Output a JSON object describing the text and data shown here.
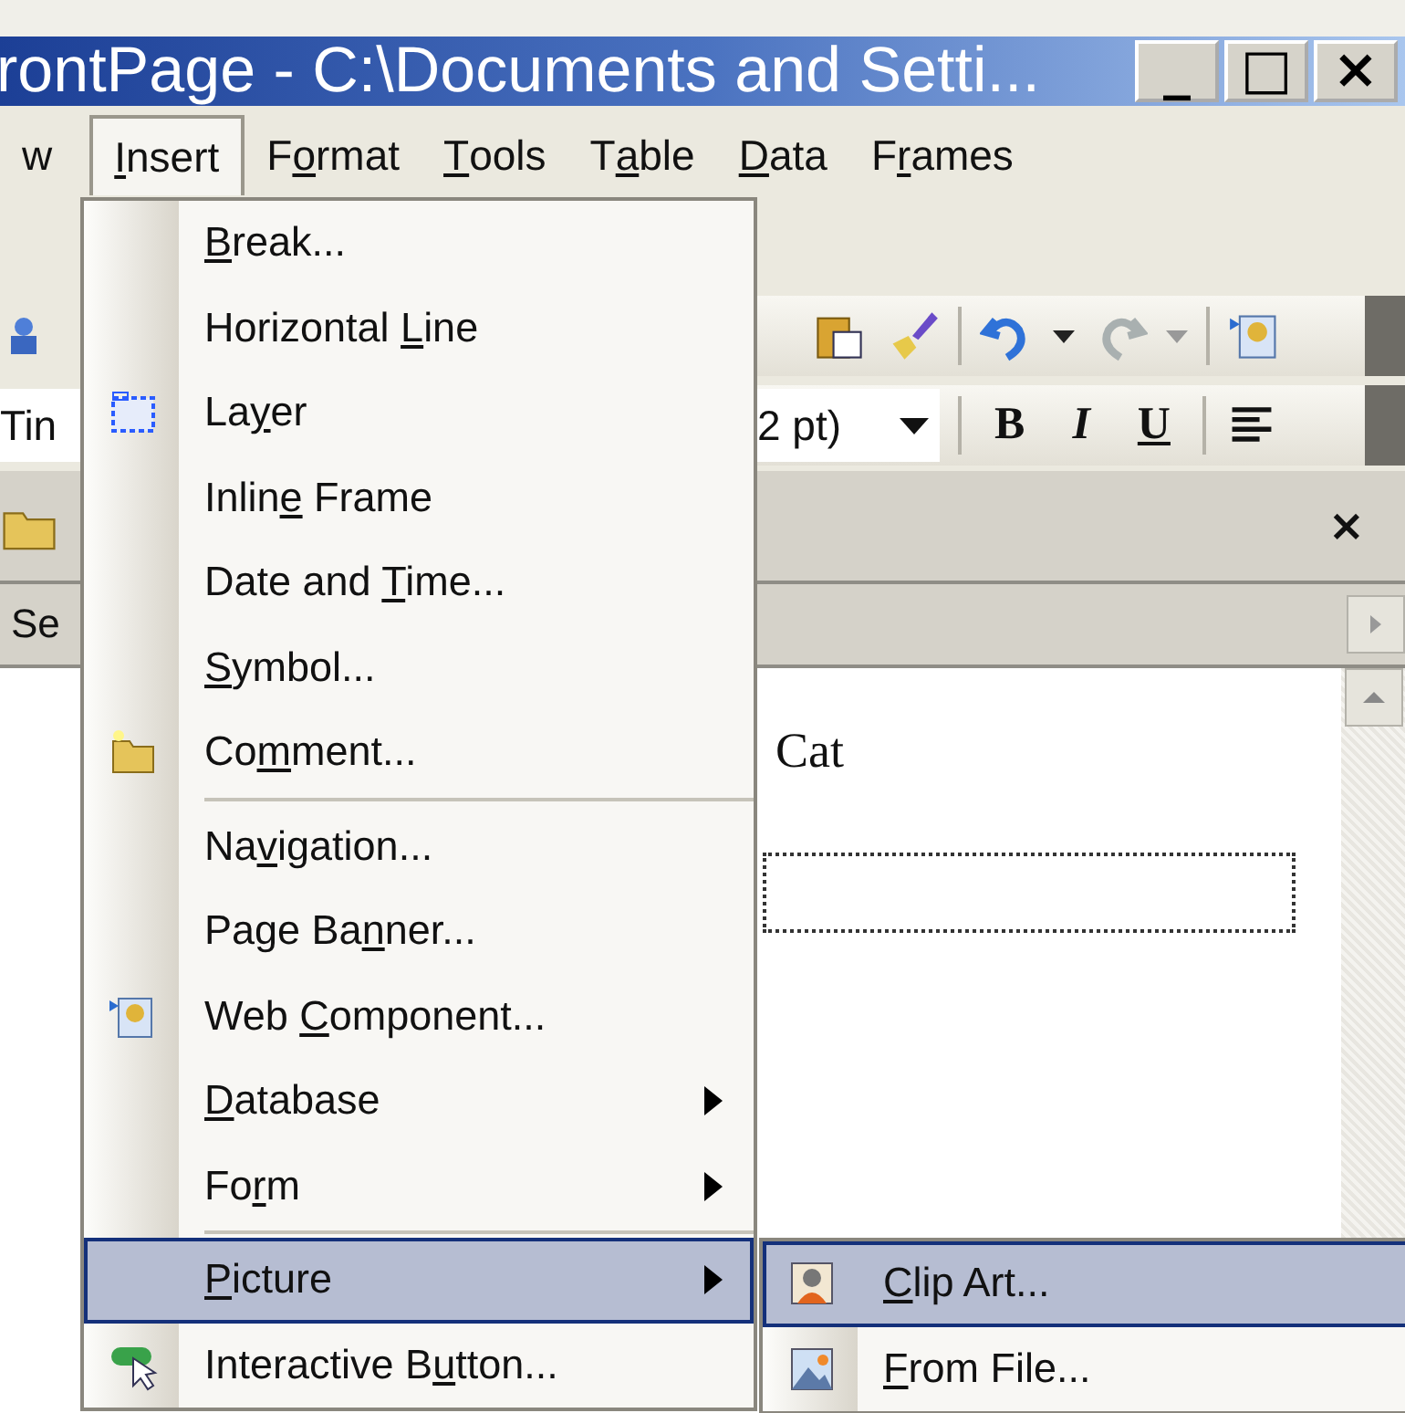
{
  "window": {
    "title": "rontPage - C:\\Documents and Setti...",
    "controls": [
      "_",
      "□",
      "×"
    ]
  },
  "menu_bar": [
    {
      "label": {
        "before": "w"
      },
      "selected": false
    },
    {
      "label": {
        "key": "I",
        "after": "nsert"
      },
      "selected": true
    },
    {
      "label": {
        "before": "F",
        "key": "o",
        "after": "rmat"
      },
      "selected": false
    },
    {
      "label": {
        "key": "T",
        "after": "ools"
      },
      "selected": false
    },
    {
      "label": {
        "before": "T",
        "key": "a",
        "after": "ble"
      },
      "selected": false
    },
    {
      "label": {
        "key": "D",
        "after": "ata"
      },
      "selected": false
    },
    {
      "label": {
        "before": "F",
        "key": "r",
        "after": "ames"
      },
      "selected": false
    }
  ],
  "formatting_toolbar": {
    "font_field": "Tin",
    "size_field": "2 pt)",
    "bold": "B",
    "italic": "I",
    "underline": "U"
  },
  "folder_pane": {
    "label": "Se"
  },
  "task_pane": {
    "close": "×"
  },
  "document": {
    "text": "Cat"
  },
  "insert_menu": [
    {
      "label": {
        "key": "B",
        "after": "reak..."
      },
      "kind": "item",
      "separator_before": false,
      "selected": false
    },
    {
      "label": {
        "before": "Horizontal ",
        "key": "L",
        "after": "ine"
      },
      "kind": "item",
      "separator_before": false,
      "selected": false
    },
    {
      "label": {
        "before": "La",
        "key": "y",
        "after": "er"
      },
      "kind": "item",
      "separator_before": false,
      "selected": false
    },
    {
      "label": {
        "before": "Inlin",
        "key": "e",
        "after": " Frame"
      },
      "kind": "item",
      "separator_before": false,
      "selected": false
    },
    {
      "label": {
        "before": "Date and ",
        "key": "T",
        "after": "ime..."
      },
      "kind": "item",
      "separator_before": false,
      "selected": false
    },
    {
      "label": {
        "key": "S",
        "after": "ymbol..."
      },
      "kind": "item",
      "separator_before": false,
      "selected": false
    },
    {
      "label": {
        "before": "Co",
        "key": "m",
        "after": "ment..."
      },
      "kind": "item",
      "separator_before": false,
      "selected": false
    },
    {
      "label": {
        "before": "Na",
        "key": "v",
        "after": "igation..."
      },
      "kind": "item",
      "separator_before": true,
      "selected": false
    },
    {
      "label": {
        "before": "Page Ba",
        "key": "n",
        "after": "ner..."
      },
      "kind": "item",
      "separator_before": false,
      "selected": false
    },
    {
      "label": {
        "before": "Web ",
        "key": "C",
        "after": "omponent..."
      },
      "kind": "item",
      "separator_before": false,
      "selected": false
    },
    {
      "label": {
        "key": "D",
        "after": "atabase"
      },
      "kind": "submenu",
      "separator_before": false,
      "selected": false
    },
    {
      "label": {
        "before": "Fo",
        "key": "r",
        "after": "m"
      },
      "kind": "submenu",
      "separator_before": false,
      "selected": false
    },
    {
      "label": {
        "key": "P",
        "after": "icture"
      },
      "kind": "submenu",
      "separator_before": true,
      "selected": true
    },
    {
      "label": {
        "before": "Interactive B",
        "key": "u",
        "after": "tton..."
      },
      "kind": "item",
      "separator_before": false,
      "selected": false
    }
  ],
  "picture_submenu": [
    {
      "label": {
        "key": "C",
        "after": "lip Art..."
      },
      "selected": true
    },
    {
      "label": {
        "key": "F",
        "after": "rom File..."
      },
      "selected": false
    }
  ]
}
